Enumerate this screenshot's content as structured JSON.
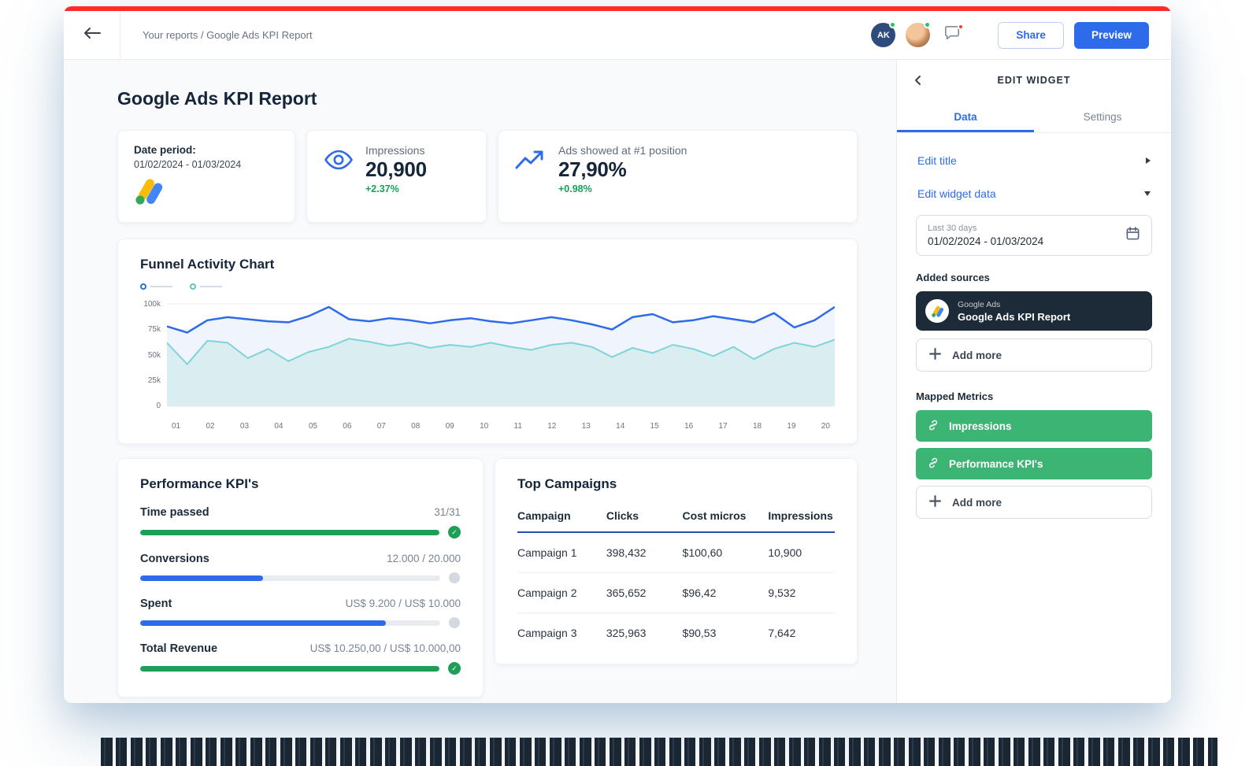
{
  "colors": {
    "accent_blue": "#2e6bea",
    "positive_green": "#18a05b",
    "progress_green": "#1d9f57",
    "metric_green": "#3cb473",
    "line_blue": "#2e6bea",
    "line_teal": "#6fcbd4",
    "dark_navy": "#1d2a38",
    "alert_red": "#ff2b2b"
  },
  "topbar": {
    "breadcrumb": "Your reports / Google Ads KPI Report",
    "avatar_initials": "AK",
    "share_label": "Share",
    "preview_label": "Preview"
  },
  "report": {
    "title": "Google Ads KPI Report",
    "kpis": [
      {
        "label": "Date period:",
        "value": "01/02/2024 - 01/03/2024"
      },
      {
        "label": "Impressions",
        "value": "20,900",
        "delta": "+2.37%"
      },
      {
        "label": "Ads showed at #1 position",
        "value": "27,90%",
        "delta": "+0.98%"
      }
    ]
  },
  "chart_data": {
    "type": "line",
    "title": "Funnel Activity Chart",
    "ylim": [
      0,
      100000
    ],
    "y_unit": "thousands",
    "grid": true,
    "legend_position": "top-left",
    "y_tick_labels": [
      "0",
      "25k",
      "50k",
      "75k",
      "100k"
    ],
    "x_tick_labels": [
      "01",
      "02",
      "03",
      "04",
      "05",
      "06",
      "07",
      "08",
      "09",
      "10",
      "11",
      "12",
      "13",
      "14",
      "15",
      "16",
      "17",
      "18",
      "19",
      "20"
    ],
    "series": [
      {
        "name": "series-blue",
        "color": "#2e6bea",
        "fill_color": "#f0f4fc",
        "values": [
          78,
          72,
          84,
          87,
          85,
          83,
          82,
          88,
          97,
          85,
          83,
          86,
          84,
          81,
          84,
          86,
          83,
          81,
          84,
          87,
          84,
          80,
          75,
          87,
          90,
          82,
          84,
          88,
          85,
          82,
          91,
          77,
          84,
          97
        ]
      },
      {
        "name": "series-teal",
        "color": "#7fd4da",
        "fill_color": "#daedf1",
        "values": [
          62,
          41,
          64,
          62,
          47,
          56,
          44,
          53,
          58,
          66,
          63,
          59,
          62,
          57,
          60,
          58,
          62,
          58,
          55,
          60,
          62,
          58,
          48,
          57,
          52,
          60,
          56,
          49,
          58,
          46,
          56,
          62,
          58,
          65
        ]
      }
    ]
  },
  "performance": {
    "title": "Performance KPI's",
    "items": [
      {
        "label": "Time passed",
        "value": "31/31",
        "progress": 100,
        "color": "green",
        "state": "complete"
      },
      {
        "label": "Conversions",
        "value": "12.000 / 20.000",
        "progress": 41,
        "color": "blue",
        "state": "in-progress"
      },
      {
        "label": "Spent",
        "value": "US$ 9.200 / US$ 10.000",
        "progress": 82,
        "color": "blue",
        "state": "in-progress"
      },
      {
        "label": "Total Revenue",
        "value": "US$ 10.250,00 / US$ 10.000,00",
        "progress": 100,
        "color": "green",
        "state": "complete"
      }
    ]
  },
  "campaigns": {
    "title": "Top Campaigns",
    "columns": [
      "Campaign",
      "Clicks",
      "Cost micros",
      "Impressions"
    ],
    "rows": [
      [
        "Campaign 1",
        "398,432",
        "$100,60",
        "10,900"
      ],
      [
        "Campaign 2",
        "365,652",
        "$96,42",
        "9,532"
      ],
      [
        "Campaign 3",
        "325,963",
        "$90,53",
        "7,642"
      ]
    ]
  },
  "panel": {
    "title": "EDIT WIDGET",
    "tabs": [
      {
        "label": "Data",
        "active": true
      },
      {
        "label": "Settings",
        "active": false
      }
    ],
    "edit_title_label": "Edit title",
    "edit_widget_data_label": "Edit widget data",
    "date_range": {
      "preset": "Last 30 days",
      "range": "01/02/2024 - 01/03/2024"
    },
    "added_sources_label": "Added sources",
    "source": {
      "provider": "Google Ads",
      "name": "Google Ads KPI Report"
    },
    "add_more_label": "Add more",
    "mapped_metrics_label": "Mapped Metrics",
    "metrics": [
      "Impressions",
      "Performance KPI's"
    ],
    "add_more_metrics_label": "Add more"
  }
}
